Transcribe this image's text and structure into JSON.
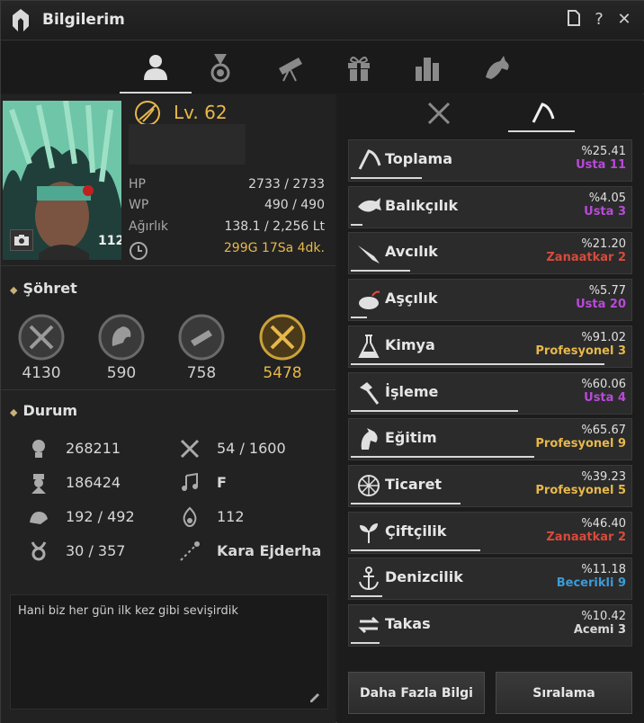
{
  "window": {
    "title": "Bilgilerim"
  },
  "tabs": [
    {
      "icon": "character-icon",
      "active": true
    },
    {
      "icon": "medal-icon"
    },
    {
      "icon": "telescope-icon"
    },
    {
      "icon": "gift-icon"
    },
    {
      "icon": "ranking-chart-icon"
    },
    {
      "icon": "pet-icon"
    }
  ],
  "character": {
    "level": "Lv. 62",
    "hp_label": "HP",
    "hp_value": "2733 / 2733",
    "wp_label": "WP",
    "wp_value": "490 / 490",
    "weight_label": "Ağırlık",
    "weight_value": "138.1 / 2,256 Lt",
    "time_value": "299G 17Sa 4dk.",
    "portrait_badge": "112"
  },
  "fame": {
    "title": "Şöhret",
    "items": [
      {
        "icon": "combat-fame-icon",
        "value": "4130"
      },
      {
        "icon": "life-fame-icon",
        "value": "590"
      },
      {
        "icon": "explore-fame-icon",
        "value": "758"
      },
      {
        "icon": "total-fame-icon",
        "value": "5478"
      }
    ]
  },
  "durum": {
    "title": "Durum",
    "left": [
      {
        "icon": "ap-icon",
        "value": "268211"
      },
      {
        "icon": "dp-icon",
        "value": "186424"
      },
      {
        "icon": "strength-icon",
        "value": "192 / 492"
      },
      {
        "icon": "contribution-icon",
        "value": "30 / 357"
      }
    ],
    "right": [
      {
        "icon": "tools-icon",
        "value": "54 / 1600"
      },
      {
        "icon": "music-icon",
        "value": "F"
      },
      {
        "icon": "energy-icon",
        "value": "112"
      },
      {
        "icon": "title-icon",
        "value": "Kara Ejderha"
      }
    ]
  },
  "memo": {
    "text": "Hani biz her gün ilk kez gibi sevişirdik"
  },
  "life_skills": [
    {
      "name": "Toplama",
      "pct": "%25.41",
      "rank": "Usta",
      "level": "11",
      "color": "#b84ad8",
      "fill": 0.2541,
      "icon": "gathering-icon"
    },
    {
      "name": "Balıkçılık",
      "pct": "%4.05",
      "rank": "Usta",
      "level": "3",
      "color": "#b84ad8",
      "fill": 0.0405,
      "icon": "fishing-icon"
    },
    {
      "name": "Avcılık",
      "pct": "%21.20",
      "rank": "Zanaatkar",
      "level": "2",
      "color": "#d84a3a",
      "fill": 0.212,
      "icon": "hunting-icon"
    },
    {
      "name": "Aşçılık",
      "pct": "%5.77",
      "rank": "Usta",
      "level": "20",
      "color": "#b84ad8",
      "fill": 0.0577,
      "icon": "cooking-icon"
    },
    {
      "name": "Kimya",
      "pct": "%91.02",
      "rank": "Profesyonel",
      "level": "3",
      "color": "#e7b84a",
      "fill": 0.9102,
      "icon": "alchemy-icon"
    },
    {
      "name": "İşleme",
      "pct": "%60.06",
      "rank": "Usta",
      "level": "4",
      "color": "#b84ad8",
      "fill": 0.6006,
      "icon": "processing-icon"
    },
    {
      "name": "Eğitim",
      "pct": "%65.67",
      "rank": "Profesyonel",
      "level": "9",
      "color": "#e7b84a",
      "fill": 0.6567,
      "icon": "training-icon"
    },
    {
      "name": "Ticaret",
      "pct": "%39.23",
      "rank": "Profesyonel",
      "level": "5",
      "color": "#e7b84a",
      "fill": 0.3923,
      "icon": "trade-icon"
    },
    {
      "name": "Çiftçilik",
      "pct": "%46.40",
      "rank": "Zanaatkar",
      "level": "2",
      "color": "#d84a3a",
      "fill": 0.464,
      "icon": "farming-icon"
    },
    {
      "name": "Denizcilik",
      "pct": "%11.18",
      "rank": "Becerikli",
      "level": "9",
      "color": "#3a9bd8",
      "fill": 0.1118,
      "icon": "sailing-icon"
    },
    {
      "name": "Takas",
      "pct": "%10.42",
      "rank": "Acemi",
      "level": "3",
      "color": "#d8d8d8",
      "fill": 0.1042,
      "icon": "barter-icon"
    }
  ],
  "buttons": {
    "more_info": "Daha Fazla Bilgi",
    "ranking": "Sıralama"
  }
}
